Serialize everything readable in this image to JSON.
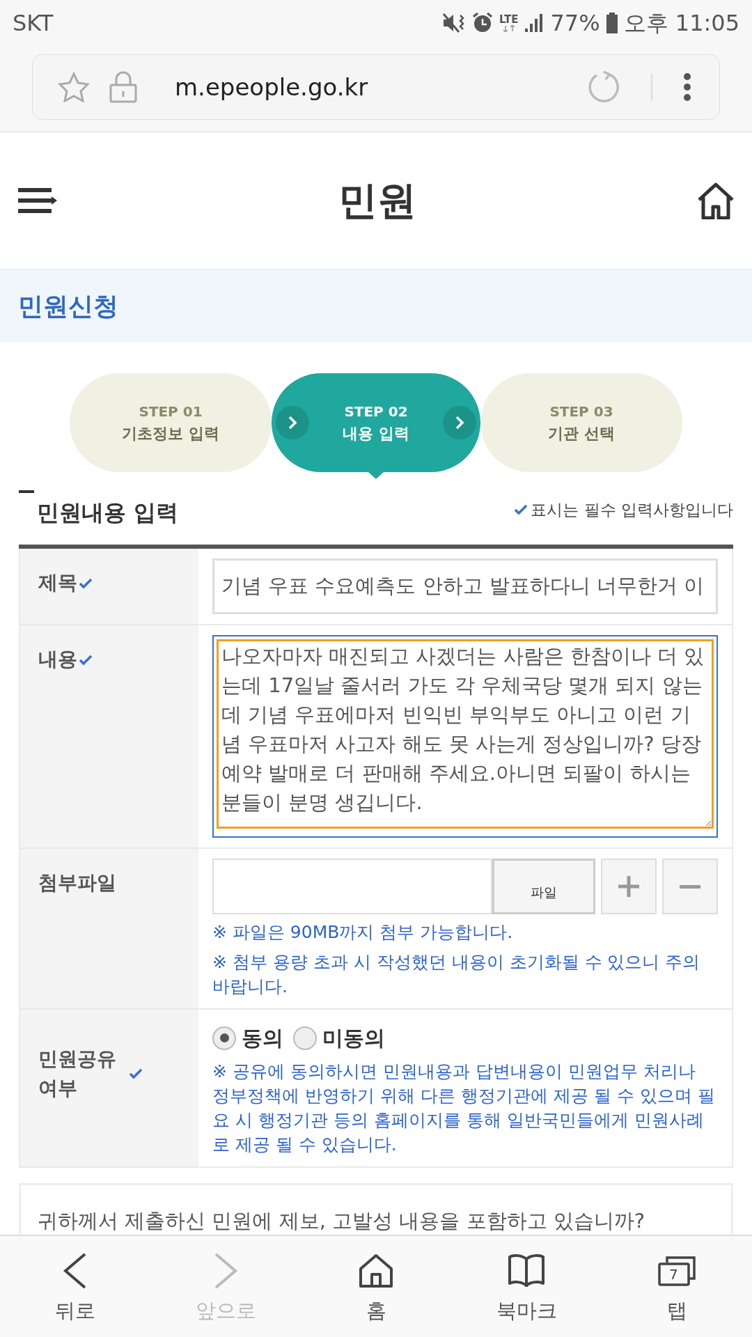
{
  "status_bar": {
    "carrier": "SKT",
    "network": "LTE",
    "battery": "77%",
    "time": "오후 11:05"
  },
  "browser": {
    "url": "m.epeople.go.kr"
  },
  "header": {
    "title": "민원"
  },
  "section_band": {
    "title": "민원신청"
  },
  "steps": [
    {
      "step": "STEP 01",
      "label": "기초정보 입력",
      "selected": false
    },
    {
      "step": "STEP 02",
      "label": "내용 입력",
      "selected": true
    },
    {
      "step": "STEP 03",
      "label": "기관 선택",
      "selected": false
    }
  ],
  "form": {
    "title": "민원내용 입력",
    "required_note": "표시는 필수 입력사항입니다",
    "fields": [
      {
        "kind": "text",
        "label": "제목",
        "required": true,
        "value": "기념 우표 수요예측도 안하고 발표하다니 너무한거 이"
      },
      {
        "kind": "textarea",
        "label": "내용",
        "required": true,
        "value": "나오자마자 매진되고 사겠더는 사람은 한참이나 더 있는데 17일날 줄서러 가도 각 우체국당 몇개 되지 않는데 기념 우표에마저 빈익빈 부익부도 아니고 이런 기념 우표마저 사고자 해도 못 사는게 정상입니까? 당장 예약 발매로 더 판매해 주세요.아니면 되팔이 하시는 분들이 분명 생깁니다."
      },
      {
        "kind": "file",
        "label": "첨부파일",
        "required": false,
        "button": "파일",
        "notes": [
          "※ 파일은 90MB까지 첨부 가능합니다.",
          "※ 첨부 용량 초과 시 작성했던 내용이 초기화될 수 있으니 주의 바랍니다."
        ]
      },
      {
        "kind": "radio",
        "label": "민원공유 여부",
        "required": true,
        "options": [
          {
            "label": "동의",
            "selected": true
          },
          {
            "label": "미동의",
            "selected": false
          }
        ],
        "notes": [
          "※ 공유에 동의하시면 민원내용과 답변내용이 민원업무 처리나 정부정책에 반영하기 위해 다른 행정기관에 제공 될 수 있으며 필요 시 행정기관 등의 홈페이지를 통해 일반국민들에게 민원사례로 제공 될 수 있습니다."
        ]
      }
    ]
  },
  "question": {
    "text": "귀하께서 제출하신 민원에 제보, 고발성 내용을 포함하고 있습니까?"
  },
  "bottom_nav": [
    {
      "label": "뒤로",
      "disabled": false
    },
    {
      "label": "앞으로",
      "disabled": true
    },
    {
      "label": "홈",
      "disabled": false
    },
    {
      "label": "북마크",
      "disabled": false
    },
    {
      "label": "탭",
      "disabled": false,
      "count": "7"
    }
  ]
}
